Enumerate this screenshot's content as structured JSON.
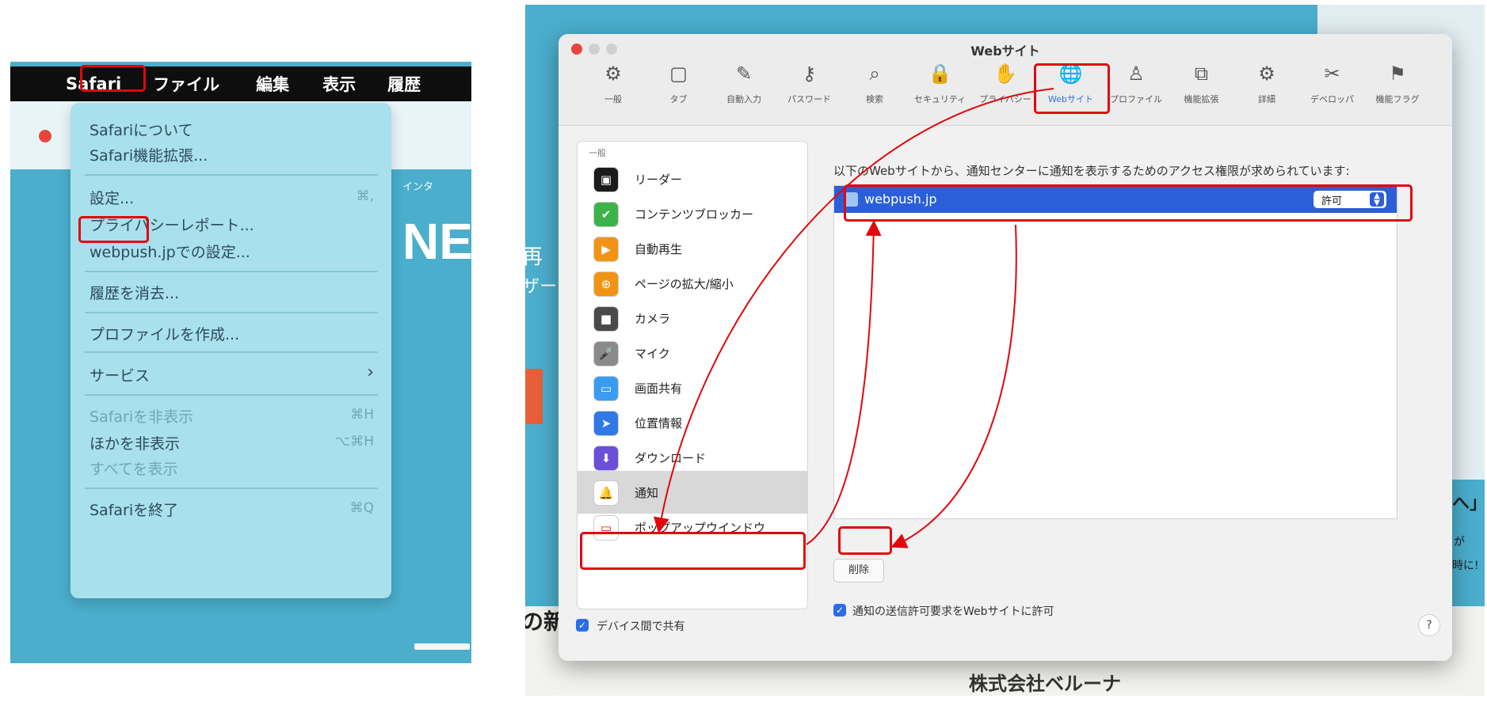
{
  "left_panel": {
    "menubar": {
      "items": [
        "Safari",
        "ファイル",
        "編集",
        "表示",
        "履歴"
      ]
    },
    "background": {
      "big_text": "NE",
      "small_text": "インタ"
    },
    "menu": {
      "items": [
        {
          "label": "Safariについて",
          "shortcut": "",
          "enabled": true
        },
        {
          "label": "Safari機能拡張...",
          "shortcut": "",
          "enabled": true
        },
        {
          "label": "設定...",
          "shortcut": "⌘,",
          "enabled": true
        },
        {
          "label": "プライバシーレポート...",
          "shortcut": "",
          "enabled": true
        },
        {
          "label": "webpush.jpでの設定...",
          "shortcut": "",
          "enabled": true
        },
        {
          "label": "履歴を消去...",
          "shortcut": "",
          "enabled": true
        },
        {
          "label": "プロファイルを作成...",
          "shortcut": "",
          "enabled": true
        },
        {
          "label": "サービス",
          "shortcut": "›",
          "enabled": true
        },
        {
          "label": "Safariを非表示",
          "shortcut": "⌘H",
          "enabled": false
        },
        {
          "label": "ほかを非表示",
          "shortcut": "⌥⌘H",
          "enabled": true
        },
        {
          "label": "すべてを表示",
          "shortcut": "",
          "enabled": false
        },
        {
          "label": "Safariを終了",
          "shortcut": "⌘Q",
          "enabled": true
        }
      ]
    }
  },
  "right_panel": {
    "background": {
      "company": "株式会社ベルーナ",
      "left_text_1": "再",
      "left_text_2": "ザー",
      "bottom_left": "の新",
      "right_text_1": "へ」",
      "right_text_2": "が",
      "right_text_3": "時に!"
    },
    "window": {
      "title": "Webサイト",
      "toolbar": [
        {
          "label": "一般",
          "icon": "gear-icon"
        },
        {
          "label": "タブ",
          "icon": "tabs-icon"
        },
        {
          "label": "自動入力",
          "icon": "autofill-icon"
        },
        {
          "label": "パスワード",
          "icon": "key-icon"
        },
        {
          "label": "検索",
          "icon": "search-icon"
        },
        {
          "label": "セキュリティ",
          "icon": "lock-icon"
        },
        {
          "label": "プライバシー",
          "icon": "hand-icon"
        },
        {
          "label": "Webサイト",
          "icon": "globe-icon",
          "selected": true
        },
        {
          "label": "プロファイル",
          "icon": "person-icon"
        },
        {
          "label": "機能拡張",
          "icon": "extension-icon"
        },
        {
          "label": "詳細",
          "icon": "gears-icon"
        },
        {
          "label": "デベロッパ",
          "icon": "tools-icon"
        },
        {
          "label": "機能フラグ",
          "icon": "flags-icon"
        }
      ],
      "sidebar": {
        "section": "一般",
        "items": [
          {
            "label": "リーダー",
            "icon": "reader-icon",
            "color": "#1b1b1b"
          },
          {
            "label": "コンテンツブロッカー",
            "icon": "content-blocker-icon",
            "color": "#3cb34a"
          },
          {
            "label": "自動再生",
            "icon": "autoplay-icon",
            "color": "#f29413"
          },
          {
            "label": "ページの拡大/縮小",
            "icon": "zoom-icon",
            "color": "#f29413"
          },
          {
            "label": "カメラ",
            "icon": "camera-icon",
            "color": "#4a4a4a"
          },
          {
            "label": "マイク",
            "icon": "microphone-icon",
            "color": "#8a8a8a"
          },
          {
            "label": "画面共有",
            "icon": "screen-share-icon",
            "color": "#3a9cf0"
          },
          {
            "label": "位置情報",
            "icon": "location-icon",
            "color": "#2f78e6"
          },
          {
            "label": "ダウンロード",
            "icon": "download-icon",
            "color": "#6b4fd8"
          },
          {
            "label": "通知",
            "icon": "notification-bell-icon",
            "color": "#ffffff",
            "selected": true
          },
          {
            "label": "ポップアップウインドウ",
            "icon": "popup-window-icon",
            "color": "#ffffff"
          }
        ]
      },
      "content": {
        "description": "以下のWebサイトから、通知センターに通知を表示するためのアクセス権限が求められています:",
        "websites": [
          {
            "site": "webpush.jp",
            "permission": "許可"
          }
        ],
        "remove_button": "削除",
        "allow_requests_label": "通知の送信許可要求をWebサイトに許可",
        "allow_requests_checked": true
      },
      "footer": {
        "share_across_devices_label": "デバイス間で共有",
        "share_checked": true,
        "help": "?"
      }
    }
  },
  "colors": {
    "highlight": "#e2060b",
    "accent_blue": "#2b5fd9",
    "bg_teal": "#4aaecc",
    "menu_bg": "#a8e0ee"
  }
}
